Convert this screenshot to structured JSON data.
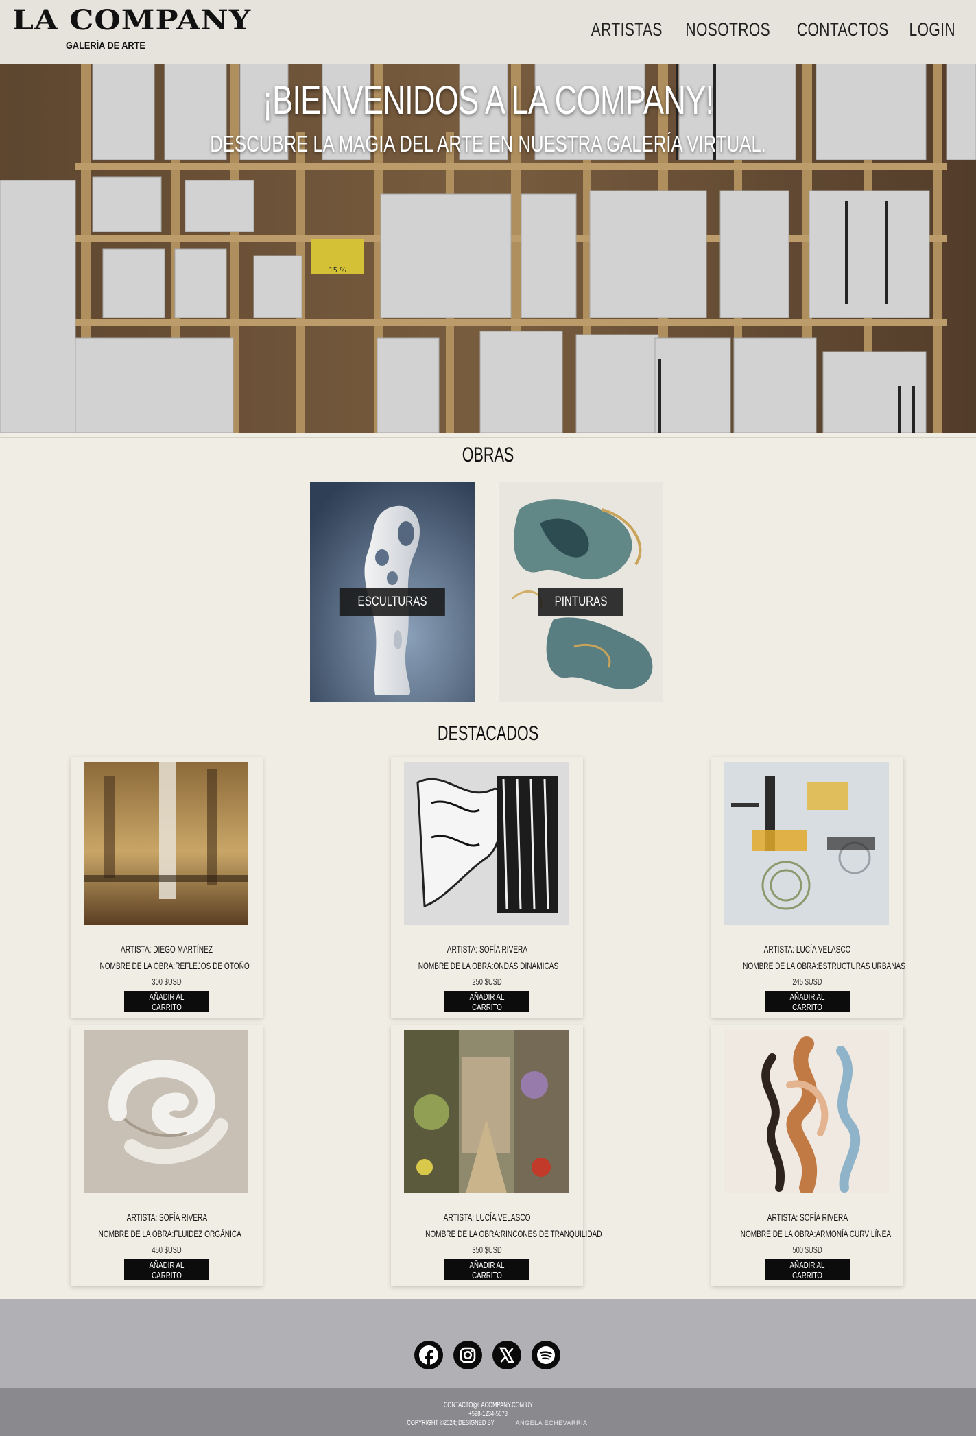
{
  "header": {
    "logo_title": "LA COMPANY",
    "logo_subtitle": "GALERÍA DE ARTE",
    "nav": [
      "ARTISTAS",
      "NOSOTROS",
      "CONTACTOS",
      "LOGIN"
    ]
  },
  "hero": {
    "title": "¡BIENVENIDOS A LA COMPANY!",
    "subtitle": "DESCUBRE LA MAGIA DEL ARTE EN NUESTRA GALERÍA VIRTUAL.",
    "shelf_tag": "15 %"
  },
  "obras": {
    "title": "OBRAS",
    "categories": [
      {
        "label": "ESCULTURAS"
      },
      {
        "label": "PINTURAS"
      }
    ]
  },
  "destacados": {
    "title": "DESTACADOS",
    "button_label": "AÑADIR AL CARRITO",
    "products": [
      {
        "artist": "ARTISTA: DIEGO MARTÍNEZ",
        "name": "NOMBRE DE LA OBRA:REFLEJOS DE OTOÑO",
        "price": "300 $USD"
      },
      {
        "artist": "ARTISTA: SOFÍA RIVERA",
        "name": "NOMBRE DE LA OBRA:ONDAS DINÁMICAS",
        "price": "250 $USD"
      },
      {
        "artist": "ARTISTA: LUCÍA VELASCO",
        "name": "NOMBRE DE LA OBRA:ESTRUCTURAS URBANAS",
        "price": "245 $USD"
      },
      {
        "artist": "ARTISTA: SOFÍA RIVERA",
        "name": "NOMBRE DE LA OBRA:FLUIDEZ ORGÁNICA",
        "price": "450 $USD"
      },
      {
        "artist": "ARTISTA: LUCÍA VELASCO",
        "name": "NOMBRE DE LA OBRA:RINCONES DE TRANQUILIDAD",
        "price": "350 $USD"
      },
      {
        "artist": "ARTISTA: SOFÍA RIVERA",
        "name": "NOMBRE DE LA OBRA:ARMONÍA CURVILÍNEA",
        "price": "500 $USD"
      }
    ]
  },
  "footer": {
    "socials": [
      "facebook-icon",
      "instagram-icon",
      "x-icon",
      "spotify-icon"
    ],
    "email": "CONTACTO@LACOMPANY.COM.UY",
    "phone": "+598-1234-5678",
    "copyright": "COPYRIGHT ©2024; DESIGNED BY",
    "designer": "ANGELA ECHEVARRIA"
  }
}
